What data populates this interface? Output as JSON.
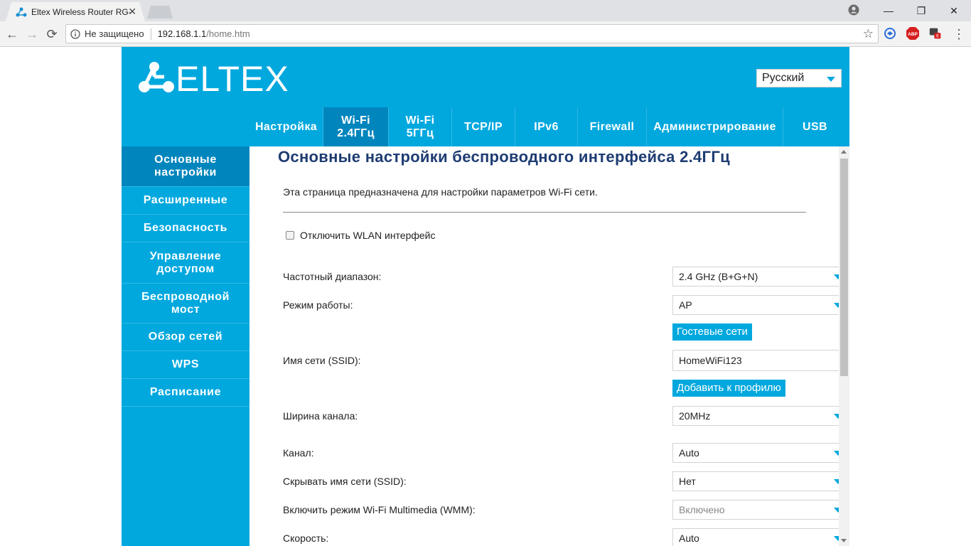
{
  "browser": {
    "tab_title": "Eltex Wireless Router RG-",
    "tab_close": "✕",
    "not_secure": "Не защищено",
    "url_host": "192.168.1.1",
    "url_path": "/home.htm",
    "abp_label": "ABP",
    "badge_count": "6",
    "win_minimize": "—",
    "win_restore": "❐",
    "win_close": "✕",
    "back": "←",
    "forward": "→",
    "reload": "⟳",
    "star": "☆",
    "menu": "⋮"
  },
  "header": {
    "logo_text": "ELTEX",
    "language": "Русский"
  },
  "topnav": [
    {
      "label": "Настройка",
      "active": false
    },
    {
      "label": "Wi-Fi\n2.4ГГц",
      "active": true
    },
    {
      "label": "Wi-Fi\n5ГГц",
      "active": false
    },
    {
      "label": "TCP/IP",
      "active": false
    },
    {
      "label": "IPv6",
      "active": false
    },
    {
      "label": "Firewall",
      "active": false
    },
    {
      "label": "Администрирование",
      "active": false
    },
    {
      "label": "USB",
      "active": false
    }
  ],
  "sidebar": [
    {
      "label": "Основные\nнастройки",
      "active": true
    },
    {
      "label": "Расширенные",
      "active": false
    },
    {
      "label": "Безопасность",
      "active": false
    },
    {
      "label": "Управление\nдоступом",
      "active": false
    },
    {
      "label": "Беспроводной\nмост",
      "active": false
    },
    {
      "label": "Обзор сетей",
      "active": false
    },
    {
      "label": "WPS",
      "active": false
    },
    {
      "label": "Расписание",
      "active": false
    }
  ],
  "content": {
    "title": "Основные настройки беспроводного интерфейса 2.4ГГц",
    "description": "Эта страница предназначена для настройки параметров Wi-Fi сети.",
    "disable_wlan_label": "Отключить WLAN интерфейс",
    "disable_wlan_checked": false,
    "freq_label": "Частотный диапазон:",
    "freq_value": "2.4 GHz (B+G+N)",
    "mode_label": "Режим работы:",
    "mode_value": "AP",
    "guest_btn": "Гостевые сети",
    "ssid_label": "Имя сети (SSID):",
    "ssid_value": "HomeWiFi123",
    "add_profile_btn": "Добавить к профилю",
    "width_label": "Ширина канала:",
    "width_value": "20MHz",
    "channel_label": "Канал:",
    "channel_value": "Auto",
    "hide_ssid_label": "Скрывать имя сети (SSID):",
    "hide_ssid_value": "Нет",
    "wmm_label": "Включить режим Wi-Fi Multimedia (WMM):",
    "wmm_value": "Включено",
    "speed_label": "Скорость:",
    "speed_value": "Auto"
  },
  "colors": {
    "brand": "#00a8de",
    "active_nav": "#0085bd",
    "title": "#1e3c72"
  }
}
